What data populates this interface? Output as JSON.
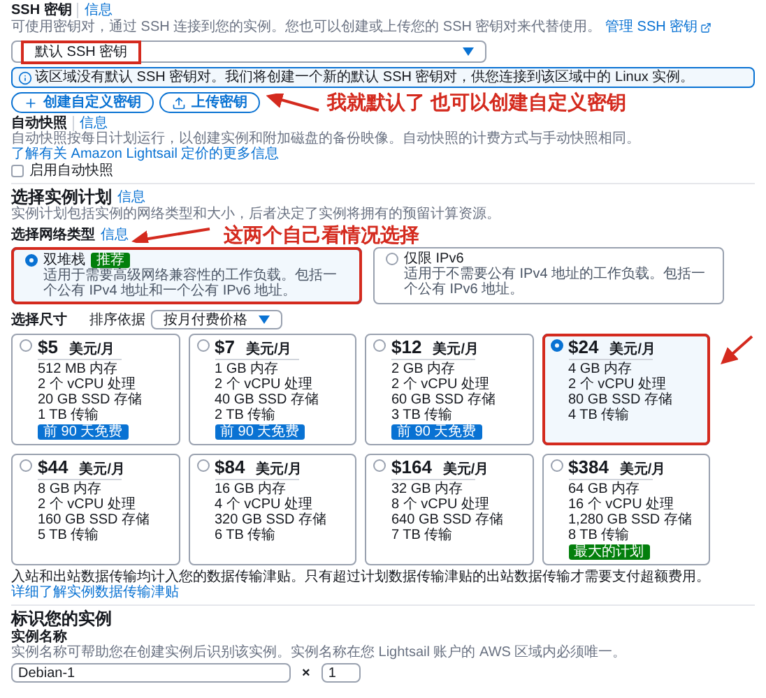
{
  "ssh_key": {
    "label": "SSH 密钥",
    "info": "信息",
    "description": "可使用密钥对，通过 SSH 连接到您的实例。您也可以创建或上传您的 SSH 密钥对来代替使用。",
    "manage_link": "管理 SSH 密钥",
    "select": {
      "value": "默认 SSH 密钥",
      "annotated": true
    },
    "alert": "该区域没有默认 SSH 密钥对。我们将创建一个新的默认 SSH 密钥对，供您连接到该区域中的 Linux 实例。",
    "buttons": [
      {
        "label": "创建自定义密钥",
        "kind": "create"
      },
      {
        "label": "上传密钥",
        "kind": "upload"
      }
    ],
    "annotation": "我就默认了 也可以创建自定义密钥"
  },
  "auto_snapshot": {
    "label": "自动快照",
    "info": "信息",
    "description": "自动快照按每日计划运行，以创建实例和附加磁盘的备份映像。自动快照的计费方式与手动快照相同。",
    "link": "了解有关 Amazon Lightsail 定价的更多信息",
    "checkbox": {
      "label": "启用自动快照",
      "checked": false
    }
  },
  "instance_plan": {
    "title": "选择实例计划",
    "info": "信息",
    "description": "实例计划包括实例的网络类型和大小，后者决定了实例将拥有的预留计算资源。",
    "network": {
      "label": "选择网络类型",
      "info": "信息",
      "annotation": "这两个自己看情况选择",
      "options": [
        {
          "label": "双堆栈",
          "badge": "推荐",
          "description": "适用于需要高级网络兼容性的工作负载。包括一个公有 IPv4 地址和一个公有 IPv6 地址。",
          "selected": true,
          "annotated": true
        },
        {
          "label": "仅限 IPv6",
          "description": "适用于不需要公有 IPv4 地址的工作负载。包括一个公有 IPv6 地址。",
          "selected": false,
          "annotated": false
        }
      ]
    },
    "size": {
      "label": "选择尺寸",
      "sort_label": "排序依据",
      "sort_value": "按月付费价格",
      "plans": [
        {
          "price": "$5",
          "unit": "美元/月",
          "specs": [
            "512 MB 内存",
            "2 个 vCPU 处理",
            "20 GB SSD 存储",
            "1 TB 传输"
          ],
          "badge": {
            "label": "前 90 天免费",
            "color": "#0972d3"
          },
          "selected": false,
          "annotated": false
        },
        {
          "price": "$7",
          "unit": "美元/月",
          "specs": [
            "1 GB 内存",
            "2 个 vCPU 处理",
            "40 GB SSD 存储",
            "2 TB 传输"
          ],
          "badge": {
            "label": "前 90 天免费",
            "color": "#0972d3"
          },
          "selected": false,
          "annotated": false
        },
        {
          "price": "$12",
          "unit": "美元/月",
          "specs": [
            "2 GB 内存",
            "2 个 vCPU 处理",
            "60 GB SSD 存储",
            "3 TB 传输"
          ],
          "badge": {
            "label": "前 90 天免费",
            "color": "#0972d3"
          },
          "selected": false,
          "annotated": false
        },
        {
          "price": "$24",
          "unit": "美元/月",
          "specs": [
            "4 GB 内存",
            "2 个 vCPU 处理",
            "80 GB SSD 存储",
            "4 TB 传输"
          ],
          "selected": true,
          "annotated": true
        },
        {
          "price": "$44",
          "unit": "美元/月",
          "specs": [
            "8 GB 内存",
            "2 个 vCPU 处理",
            "160 GB SSD 存储",
            "5 TB 传输"
          ],
          "selected": false,
          "annotated": false
        },
        {
          "price": "$84",
          "unit": "美元/月",
          "specs": [
            "16 GB 内存",
            "4 个 vCPU 处理",
            "320 GB SSD 存储",
            "6 TB 传输"
          ],
          "selected": false,
          "annotated": false
        },
        {
          "price": "$164",
          "unit": "美元/月",
          "specs": [
            "32 GB 内存",
            "8 个 vCPU 处理",
            "640 GB SSD 存储",
            "7 TB 传输"
          ],
          "selected": false,
          "annotated": false
        },
        {
          "price": "$384",
          "unit": "美元/月",
          "specs": [
            "64 GB 内存",
            "16 个 vCPU 处理",
            "1,280 GB SSD 存储",
            "8 TB 传输"
          ],
          "badge": {
            "label": "最大的计划",
            "color": "#037f0c"
          },
          "selected": false,
          "annotated": false
        }
      ]
    },
    "transfer_note": "入站和出站数据传输均计入您的数据传输津贴。只有超过计划数据传输津贴的出站数据传输才需要支付超额费用。",
    "transfer_link": "详细了解实例数据传输津贴"
  },
  "identify": {
    "title": "标识您的实例",
    "name_label": "实例名称",
    "name_description": "实例名称可帮助您在创建实例后识别该实例。实例名称在您 Lightsail 账户的 AWS 区域内必须唯一。",
    "name_value": "Debian-1",
    "times": "×",
    "count": "1"
  }
}
